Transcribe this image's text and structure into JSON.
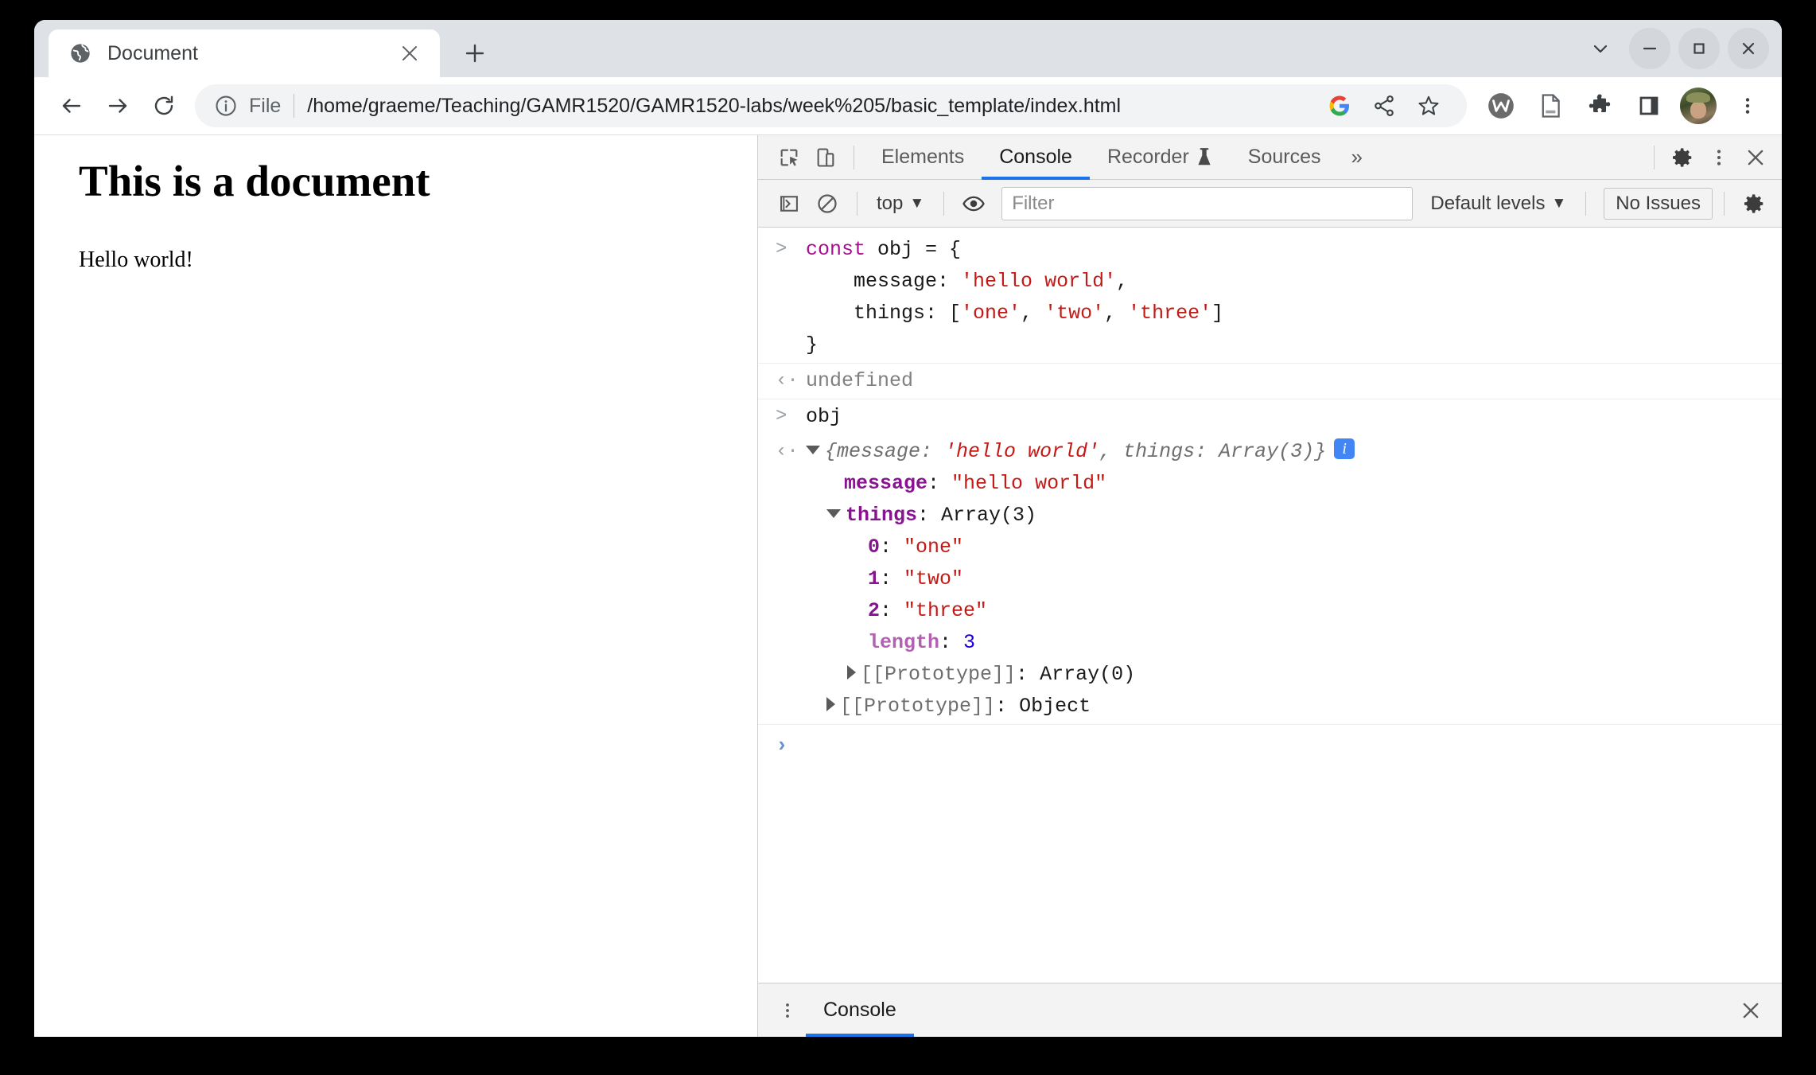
{
  "window": {
    "controls": {
      "tab_search": "tab-search-chevron",
      "minimize": "minimize",
      "maximize": "maximize",
      "close": "close"
    }
  },
  "tabstrip": {
    "tab": {
      "title": "Document",
      "favicon": "globe-icon",
      "close_label": "×"
    },
    "new_tab_label": "+"
  },
  "toolbar": {
    "back_label": "back-icon",
    "forward_label": "forward-icon",
    "reload_label": "reload-icon",
    "omnibox": {
      "info_icon": "info-circle-icon",
      "scheme_label": "File",
      "url": "/home/graeme/Teaching/GAMR1520/GAMR1520-labs/week%205/basic_template/index.html"
    },
    "actions": [
      {
        "name": "google-lens-icon",
        "label": "G"
      },
      {
        "name": "share-icon",
        "label": ""
      },
      {
        "name": "bookmark-star-icon",
        "label": ""
      }
    ],
    "extensions": [
      {
        "name": "wallet-extension-icon",
        "label": ""
      },
      {
        "name": "document-extension-icon",
        "label": ""
      },
      {
        "name": "puzzle-extensions-icon",
        "label": ""
      },
      {
        "name": "side-panel-icon",
        "label": ""
      }
    ],
    "profile_label": "avatar",
    "menu_label": "⋮"
  },
  "page": {
    "heading": "This is a document",
    "paragraph": "Hello world!"
  },
  "devtools": {
    "tabs": [
      {
        "label": "Elements",
        "active": false
      },
      {
        "label": "Console",
        "active": true
      },
      {
        "label": "Recorder",
        "active": false,
        "icon": "flask-icon"
      },
      {
        "label": "Sources",
        "active": false
      }
    ],
    "overflow_label": "»",
    "inspect_icon": "inspect-element-icon",
    "device_icon": "device-toolbar-icon",
    "settings_icon": "settings-gear-icon",
    "more_icon": "more-options-icon",
    "close_icon": "close-devtools-icon",
    "console_toolbar": {
      "sidebar_icon": "console-sidebar-icon",
      "clear_icon": "clear-console-icon",
      "context_label": "top",
      "context_caret": "▼",
      "eye_icon": "live-expression-icon",
      "filter_placeholder": "Filter",
      "filter_value": "",
      "levels_label": "Default levels",
      "levels_caret": "▼",
      "issues_label": "No Issues",
      "settings_icon": "console-settings-icon"
    },
    "console_rows": {
      "input1_gutter": ">",
      "input1_line1_kw": "const",
      "input1_line1_rest": " obj = {",
      "input1_line2_name": "    message: ",
      "input1_line2_str": "'hello world'",
      "input1_line2_tail": ",",
      "input1_line3_name": "    things: [",
      "input1_line3_s1": "'one'",
      "input1_line3_c1": ", ",
      "input1_line3_s2": "'two'",
      "input1_line3_c2": ", ",
      "input1_line3_s3": "'three'",
      "input1_line3_tail": "]",
      "input1_line4": "}",
      "output1_gutter": "‹·",
      "output1_value": "undefined",
      "input2_gutter": ">",
      "input2_value": "obj",
      "output2_gutter": "‹·",
      "preview_open": "{",
      "preview_k1": "message: ",
      "preview_v1": "'hello world'",
      "preview_sep": ", ",
      "preview_k2": "things: ",
      "preview_v2": "Array(3)",
      "preview_close": "}",
      "info_badge": "i",
      "prop_message_name": "message",
      "prop_message_colon": ": ",
      "prop_message_value": "\"hello world\"",
      "prop_things_name": "things",
      "prop_things_colon": ": ",
      "prop_things_value": "Array(3)",
      "arr_0_name": "0",
      "arr_0_value": "\"one\"",
      "arr_1_name": "1",
      "arr_1_value": "\"two\"",
      "arr_2_name": "2",
      "arr_2_value": "\"three\"",
      "arr_length_name": "length",
      "arr_length_value": "3",
      "proto_array_name": "[[Prototype]]",
      "proto_array_value": "Array(0)",
      "proto_object_name": "[[Prototype]]",
      "proto_object_value": "Object",
      "prompt_caret": "›"
    },
    "drawer": {
      "menu_icon": "drawer-more-icon",
      "tab_label": "Console",
      "close_icon": "drawer-close-icon"
    }
  },
  "colors": {
    "accent_blue": "#1a73e8",
    "tabstrip_bg": "#dee1e6",
    "devtools_bg": "#f3f3f3",
    "keyword_purple": "#aa0d91",
    "string_red": "#c41a16",
    "property_purple": "#881391",
    "number_blue": "#1c00cf",
    "badge_blue": "#4285f4"
  }
}
